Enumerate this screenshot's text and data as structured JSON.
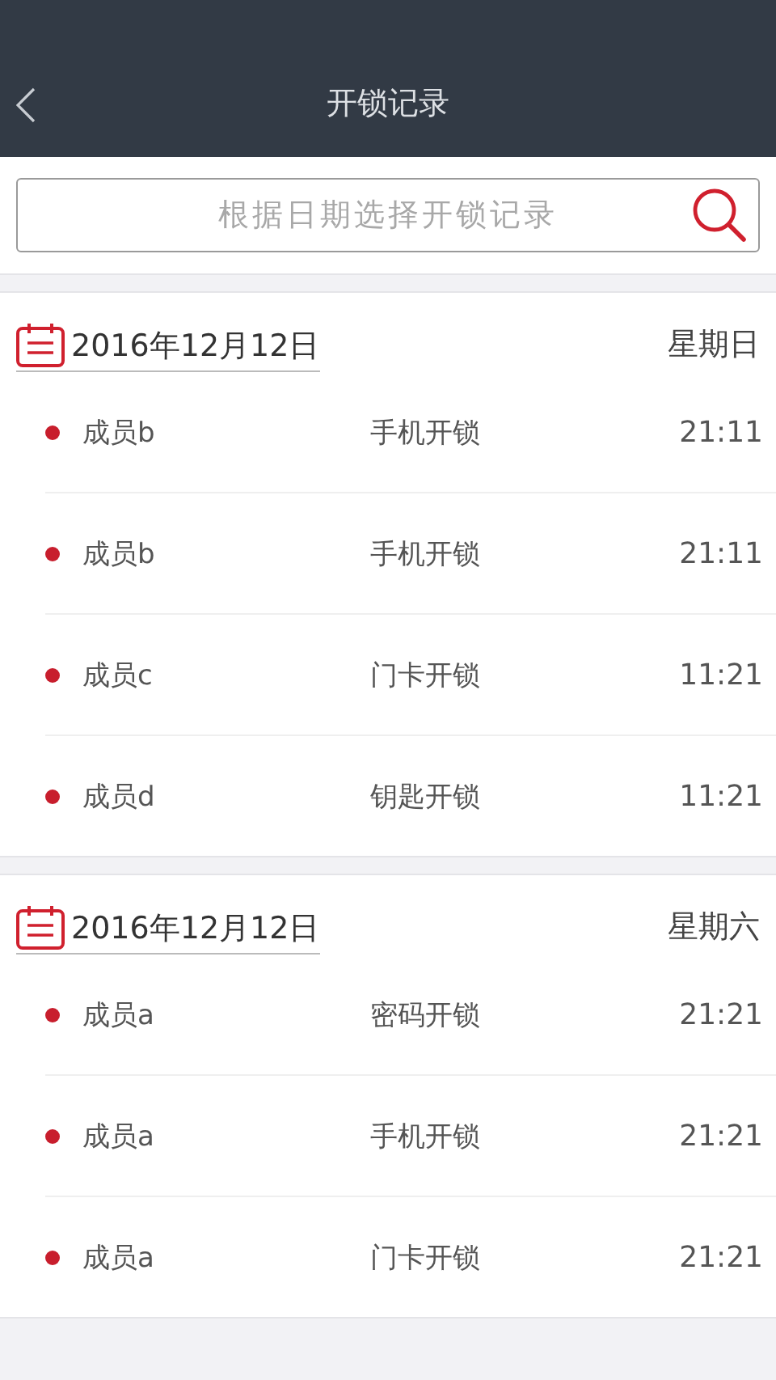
{
  "header": {
    "title": "开锁记录"
  },
  "search": {
    "placeholder": "根据日期选择开锁记录"
  },
  "days": [
    {
      "date": "2016年12月12日",
      "weekday": "星期日",
      "records": [
        {
          "member": "成员b",
          "method": "手机开锁",
          "time": "21:11"
        },
        {
          "member": "成员b",
          "method": "手机开锁",
          "time": "21:11"
        },
        {
          "member": "成员c",
          "method": "门卡开锁",
          "time": "11:21"
        },
        {
          "member": "成员d",
          "method": "钥匙开锁",
          "time": "11:21"
        }
      ]
    },
    {
      "date": "2016年12月12日",
      "weekday": "星期六",
      "records": [
        {
          "member": "成员a",
          "method": "密码开锁",
          "time": "21:21"
        },
        {
          "member": "成员a",
          "method": "手机开锁",
          "time": "21:21"
        },
        {
          "member": "成员a",
          "method": "门卡开锁",
          "time": "21:21"
        }
      ]
    }
  ]
}
